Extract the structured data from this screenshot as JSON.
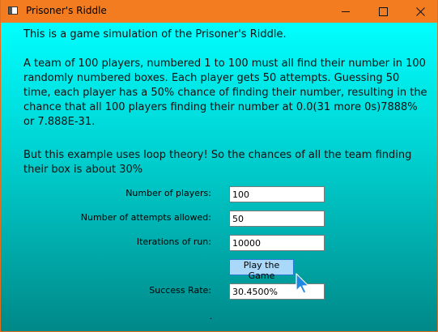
{
  "window": {
    "title": "Prisoner's Riddle",
    "controls": {
      "minimize": "minimize",
      "maximize": "maximize",
      "close": "close"
    }
  },
  "main": {
    "intro": "This is a game simulation of the Prisoner's Riddle.",
    "description": "A team of 100 players, numbered 1 to 100 must all find their number in 100 randomly numbered boxes.  Each player gets 50 attempts.  Guessing 50 time, each player  has a 50% chance of finding their number, resulting in the chance that all 100 players finding  their number at 0.0(31 more 0s)7888% or 7.888E-31.",
    "loop_note": "But this example uses loop theory! So the chances of all the team finding their box is about 30%",
    "fields": {
      "players": {
        "label": "Number of players:",
        "value": "100"
      },
      "attempts": {
        "label": "Number of attempts allowed:",
        "value": "50"
      },
      "iterations": {
        "label": "Iterations of run:",
        "value": "10000"
      },
      "success": {
        "label": "Success Rate:",
        "value": "30.4500%"
      }
    },
    "play_button": "Play the Game",
    "footer_dot": "."
  },
  "colors": {
    "titlebar": "#f47c20",
    "gradient_top": "#00ffff",
    "gradient_bottom": "#008888",
    "button_bg": "#a9d8f8",
    "button_border": "#2a7bd8",
    "cursor": "#1e88e5"
  },
  "icons": {
    "app": "window-icon",
    "cursor": "mouse-pointer-icon"
  }
}
